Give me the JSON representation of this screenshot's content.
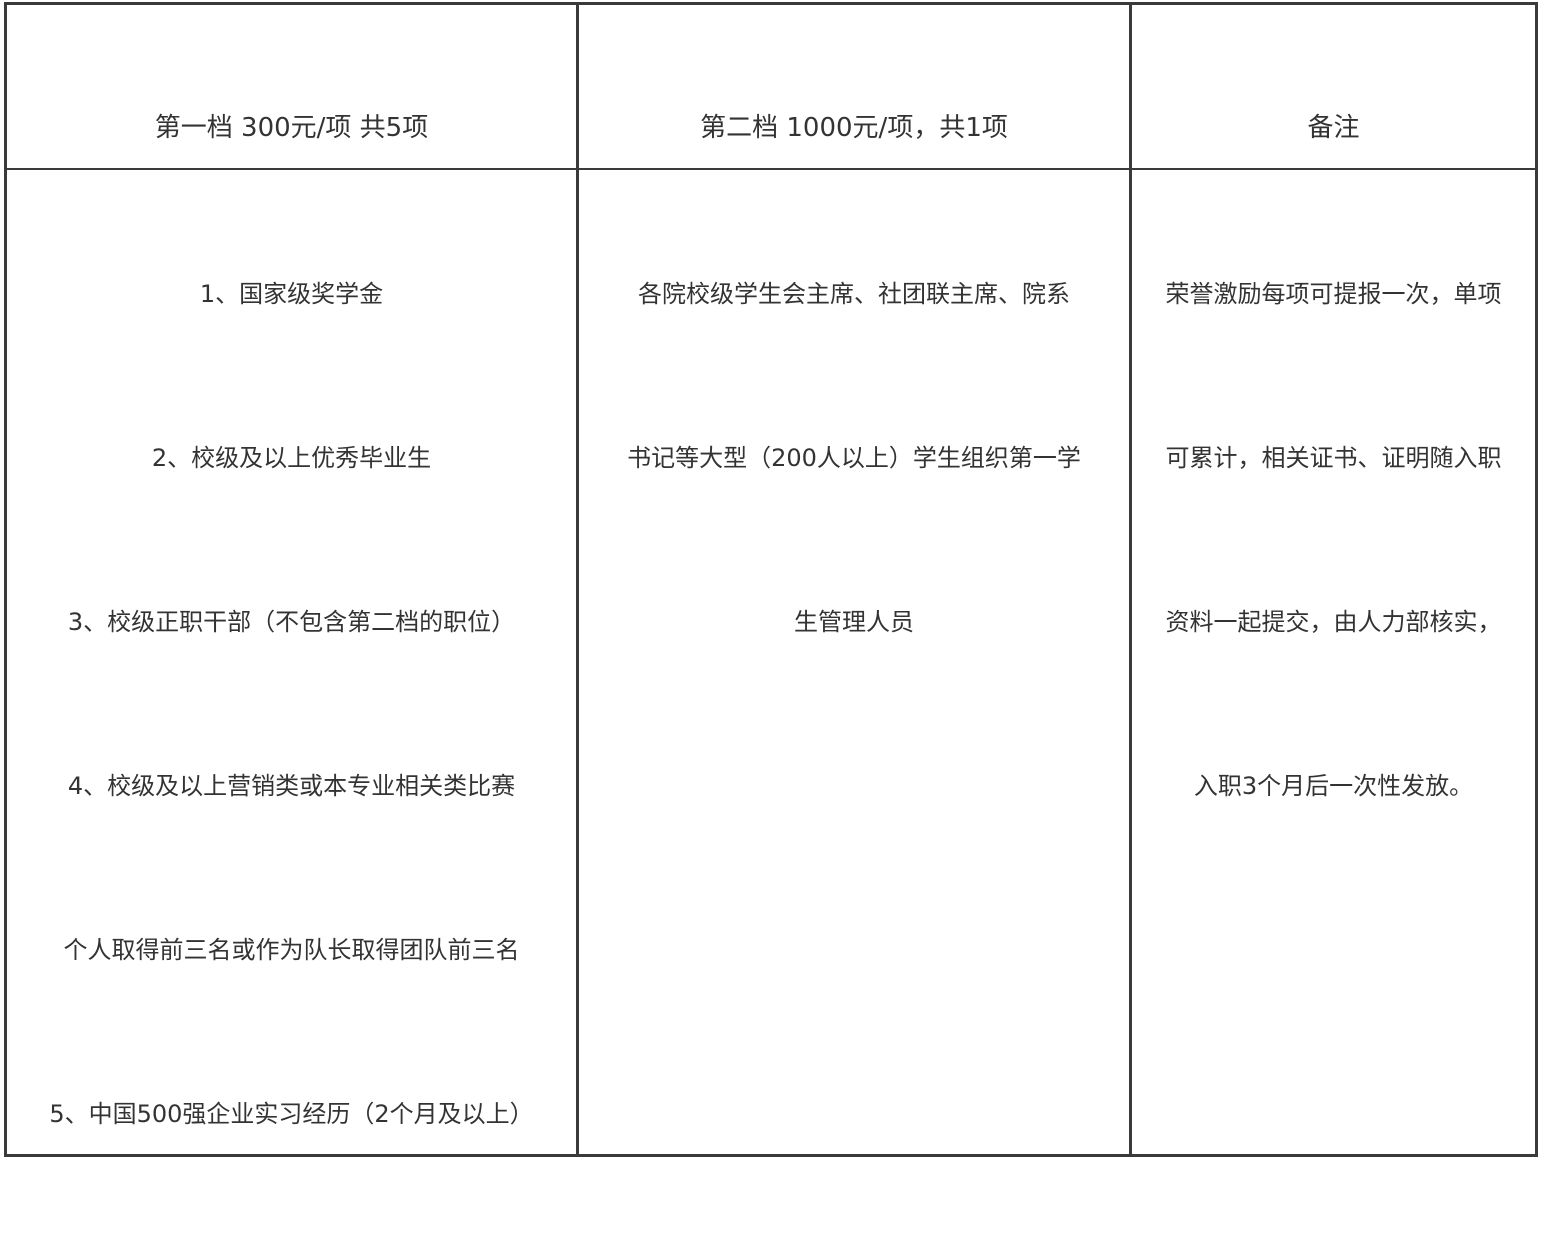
{
  "table": {
    "headers": [
      "第一档 300元/项  共5项",
      "第二档 1000元/项，共1项",
      "备注"
    ],
    "columns": [
      [
        "1、国家级奖学金",
        "2、校级及以上优秀毕业生",
        "3、校级正职干部（不包含第二档的职位）",
        "4、校级及以上营销类或本专业相关类比赛",
        "个人取得前三名或作为队长取得团队前三名",
        "5、中国500强企业实习经历（2个月及以上）"
      ],
      [
        "各院校级学生会主席、社团联主席、院系",
        "书记等大型（200人以上）学生组织第一学",
        "生管理人员"
      ],
      [
        "荣誉激励每项可提报一次，单项",
        "可累计，相关证书、证明随入职",
        "资料一起提交，由人力部核实，",
        "入职3个月后一次性发放。"
      ]
    ]
  }
}
